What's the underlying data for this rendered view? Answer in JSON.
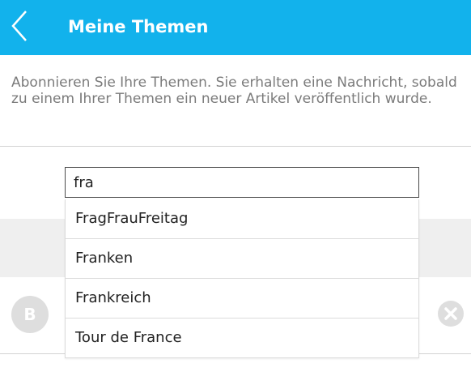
{
  "header": {
    "title": "Meine Themen",
    "back_icon": "chevron-left-icon",
    "background": "#12b2ec"
  },
  "intro": {
    "text": "Abonnieren Sie Ihre Themen. Sie erhalten eine Nachricht, sobald zu einem Ihrer Themen ein neuer Artikel veröffentlich wurde."
  },
  "search": {
    "value": "fra"
  },
  "suggestions": [
    {
      "label": "FragFrauFreitag"
    },
    {
      "label": "Franken"
    },
    {
      "label": "Frankreich"
    },
    {
      "label": "Tour de France"
    }
  ],
  "topic_row": {
    "avatar_letter": "B",
    "remove_icon": "close-circle-icon"
  }
}
